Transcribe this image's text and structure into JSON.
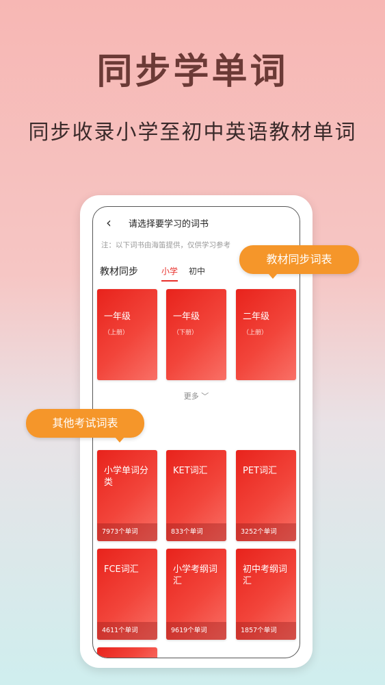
{
  "promo": {
    "headline": "同步学单词",
    "subline": "同步收录小学至初中英语教材单词"
  },
  "app": {
    "nav": {
      "back_icon": "chevron-left-icon",
      "title": "请选择要学习的词书"
    },
    "note": "注：以下词书由海笛提供，仅供学习参考",
    "section_label": "教材同步",
    "tabs": [
      {
        "label": "小学",
        "active": true
      },
      {
        "label": "初中",
        "active": false
      }
    ],
    "textbook_cards": [
      {
        "title": "一年级",
        "sub": "（上册）"
      },
      {
        "title": "一年级",
        "sub": "（下册）"
      },
      {
        "title": "二年级",
        "sub": "（上册）"
      }
    ],
    "more_label": "更多 ﹀",
    "exam_cards": [
      {
        "title": "小学单词分类",
        "count": "7973个单词"
      },
      {
        "title": "KET词汇",
        "count": "833个单词"
      },
      {
        "title": "PET词汇",
        "count": "3252个单词"
      },
      {
        "title": "FCE词汇",
        "count": "4611个单词"
      },
      {
        "title": "小学考纲词汇",
        "count": "9619个单词"
      },
      {
        "title": "初中考纲词汇",
        "count": "1857个单词"
      }
    ]
  },
  "bubbles": {
    "textbook": "教材同步词表",
    "exam": "其他考试词表"
  },
  "colors": {
    "accent": "#e8302b",
    "bubble": "#f5962a",
    "headline": "#6b3a36"
  }
}
